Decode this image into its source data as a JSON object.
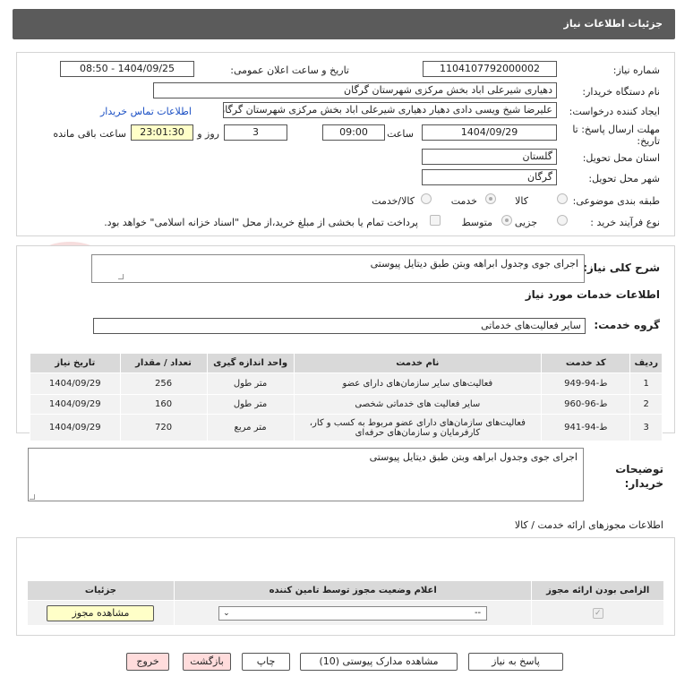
{
  "header": {
    "title": "جزئیات اطلاعات نیاز"
  },
  "form": {
    "need_number_label": "شماره نیاز:",
    "need_number": "1104107792000002",
    "announce_label": "تاریخ و ساعت اعلان عمومی:",
    "announce_value": "1404/09/25 - 08:50",
    "buyer_org_label": "نام دستگاه خریدار:",
    "buyer_org": "دهیاری شیرعلی اباد بخش مرکزی شهرستان گرگان",
    "creator_label": "ایجاد کننده درخواست:",
    "creator": "علیرضا شیخ ویسی دادی دهیار دهیاری شیرعلی اباد بخش مرکزی شهرستان گرگان",
    "contact_link": "اطلاعات تماس خریدار",
    "deadline_label": "مهلت ارسال پاسخ: تا تاریخ:",
    "deadline_date": "1404/09/29",
    "time_label": "ساعت",
    "deadline_time": "09:00",
    "days_value": "3",
    "days_label": "روز و",
    "remaining_time": "23:01:30",
    "remaining_label": "ساعت باقی مانده",
    "province_label": "استان محل تحویل:",
    "province": "گلستان",
    "city_label": "شهر محل تحویل:",
    "city": "گرگان",
    "category_label": "طبقه بندی موضوعی:",
    "category_options": [
      "کالا",
      "خدمت",
      "کالا/خدمت"
    ],
    "process_label": "نوع فرآیند خرید :",
    "process_options": [
      "جزیی",
      "متوسط"
    ],
    "treasury_note": "پرداخت تمام یا بخشی از مبلغ خرید،از محل \"اسناد خزانه اسلامی\" خواهد بود."
  },
  "summary": {
    "label": "شرح کلی نیاز:",
    "value": "اجرای جوی وجدول ابراهه وبتن طبق دیتایل پیوستی"
  },
  "services": {
    "section_title": "اطلاعات خدمات مورد نیاز",
    "group_label": "گروه خدمت:",
    "group_value": "سایر فعالیت‌های خدماتی",
    "columns": [
      "ردیف",
      "کد خدمت",
      "نام خدمت",
      "واحد اندازه گیری",
      "تعداد / مقدار",
      "تاریخ نیاز"
    ],
    "rows": [
      {
        "idx": "1",
        "code": "ط-94-949",
        "name": "فعالیت‌های سایر سازمان‌های دارای عضو",
        "unit": "متر طول",
        "qty": "256",
        "date": "1404/09/29"
      },
      {
        "idx": "2",
        "code": "ط-96-960",
        "name": "سایر فعالیت های خدماتی شخصی",
        "unit": "متر طول",
        "qty": "160",
        "date": "1404/09/29"
      },
      {
        "idx": "3",
        "code": "ط-94-941",
        "name": "فعالیت‌های سازمان‌های دارای عضو مربوط به کسب و کار، کارفرمایان و سازمان‌های حرفه‌ای",
        "unit": "متر مربع",
        "qty": "720",
        "date": "1404/09/29"
      }
    ]
  },
  "buyer_notes": {
    "label": "توضیحات خریدار:",
    "value": "اجرای جوی وجدول ابراهه وبتن طبق دیتایل پیوستی"
  },
  "permits": {
    "section_title": "اطلاعات مجوزهای ارائه خدمت / کالا",
    "columns": [
      "الزامی بودن ارائه مجوز",
      "اعلام وضعیت مجوز توسط تامین کننده",
      "جزئیات"
    ],
    "select_value": "--",
    "view_button": "مشاهده مجوز"
  },
  "footer": {
    "reply": "پاسخ به نیاز",
    "docs": "مشاهده مدارک پیوستی (10)",
    "print": "چاپ",
    "back": "بازگشت",
    "exit": "خروج"
  },
  "colors": {
    "header_bg": "#5b5b5b",
    "link": "#1a4fc4",
    "highlight": "#ffffc8",
    "danger_btn": "#ffdcdc"
  }
}
